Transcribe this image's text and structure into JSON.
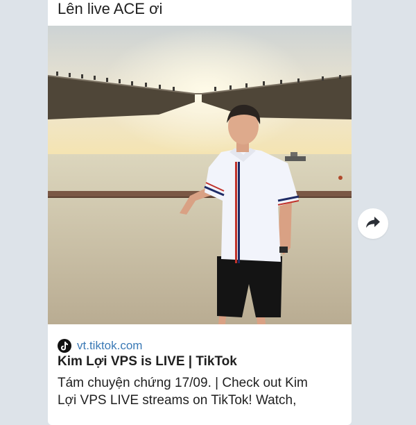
{
  "message": {
    "text": "Lên live ACE ơi"
  },
  "link_preview": {
    "icon": "tiktok-icon",
    "domain": "vt.tiktok.com",
    "title": "Kim Lợi VPS is LIVE | TikTok",
    "description_line1": "Tám chuyện chứng 17/09. | Check out Kim",
    "description_line2": "Lợi VPS LIVE streams on TikTok! Watch,"
  },
  "share_button": {
    "icon": "share-arrow-icon"
  },
  "colors": {
    "background": "#dde3e9",
    "bubble": "#ffffff",
    "link": "#3a79b5",
    "text": "#1f1f1f"
  }
}
